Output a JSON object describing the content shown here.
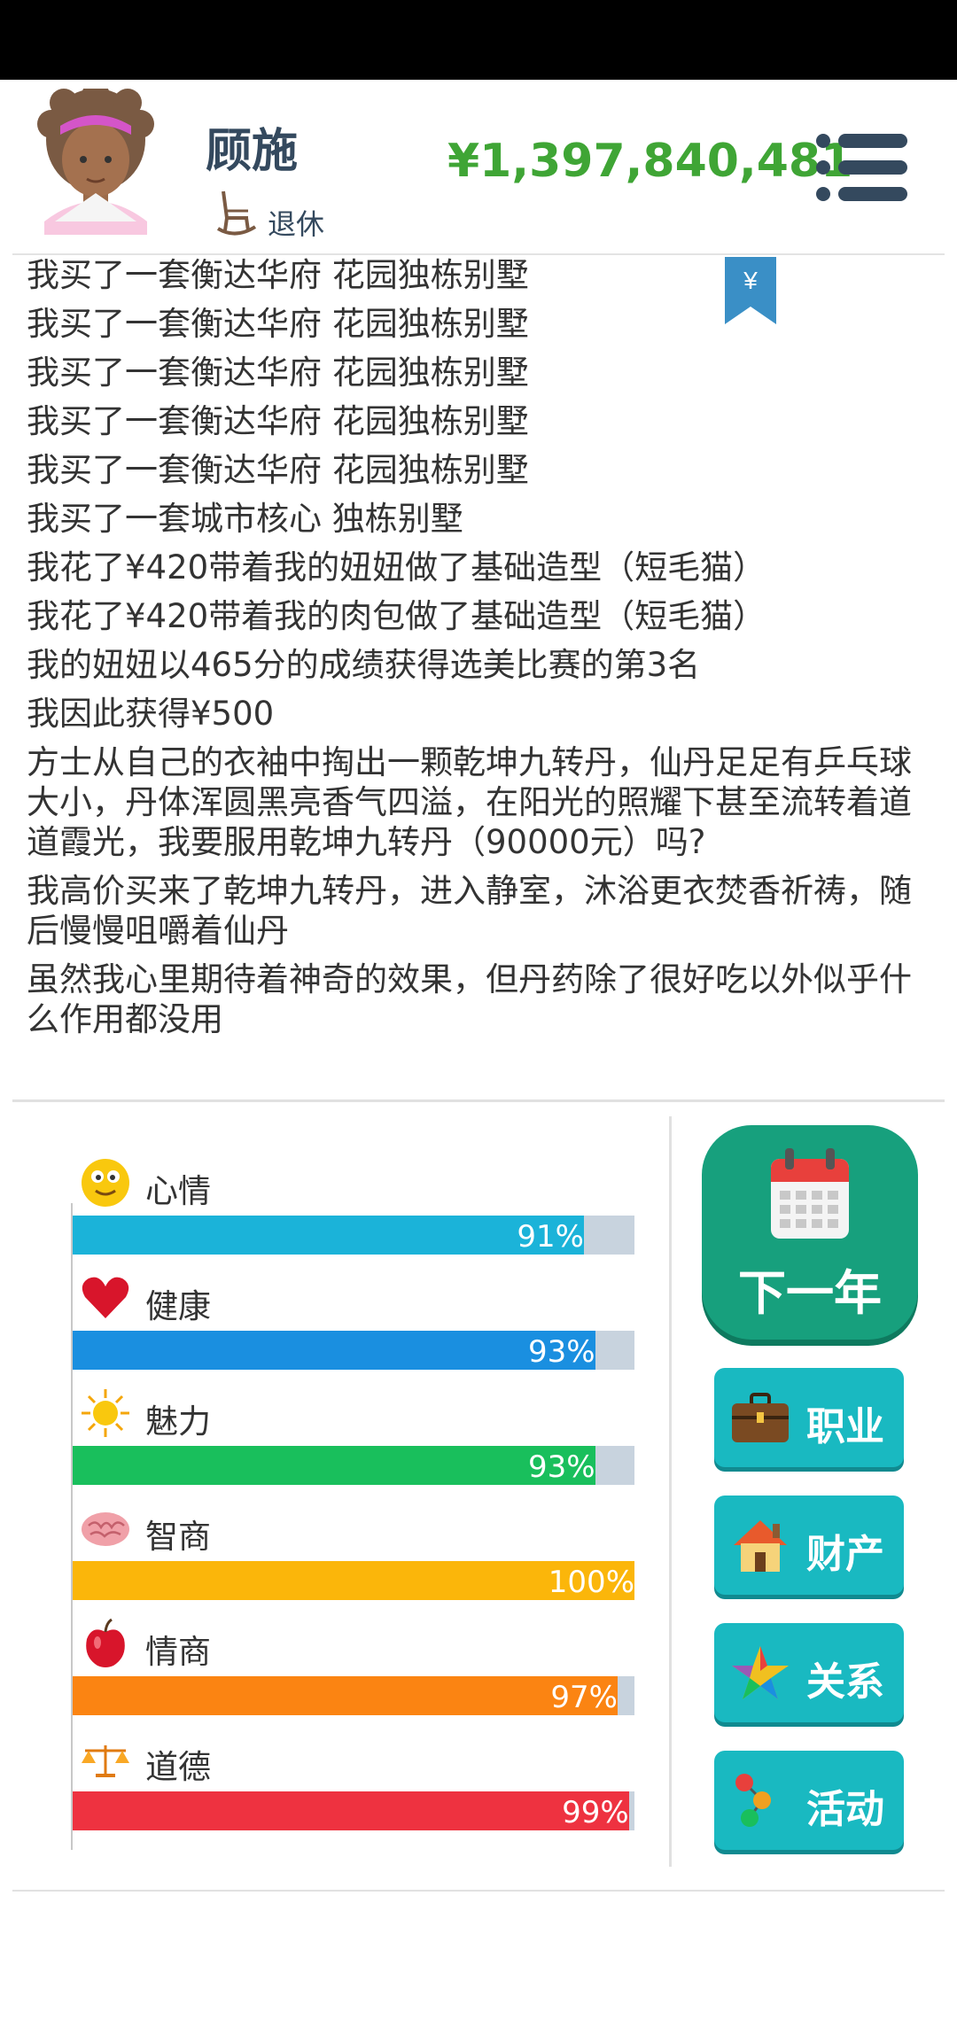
{
  "header": {
    "name": "顾施",
    "job": "退休",
    "money": "¥1,397,840,481"
  },
  "log": [
    "我买了一套衡达华府 花园独栋别墅",
    "我买了一套衡达华府 花园独栋别墅",
    "我买了一套衡达华府 花园独栋别墅",
    "我买了一套衡达华府 花园独栋别墅",
    "我买了一套衡达华府 花园独栋别墅",
    "我买了一套城市核心 独栋别墅",
    "我花了¥420带着我的妞妞做了基础造型（短毛猫）",
    "我花了¥420带着我的肉包做了基础造型（短毛猫）",
    "我的妞妞以465分的成绩获得选美比赛的第3名",
    "我因此获得¥500",
    "方士从自己的衣袖中掏出一颗乾坤九转丹，仙丹足足有乒乓球大小，丹体浑圆黑亮香气四溢，在阳光的照耀下甚至流转着道道霞光，我要服用乾坤九转丹（90000元）吗?",
    "我高价买来了乾坤九转丹，进入静室，沐浴更衣焚香祈祷，随后慢慢咀嚼着仙丹",
    "虽然我心里期待着神奇的效果，但丹药除了很好吃以外似乎什么作用都没用"
  ],
  "bookmark_symbol": "¥",
  "stats": [
    {
      "label": "心情",
      "value": 91,
      "pct": "91%",
      "color": "#1bb3d9",
      "icon": "smiley-icon"
    },
    {
      "label": "健康",
      "value": 93,
      "pct": "93%",
      "color": "#1a8fe0",
      "icon": "heart-icon"
    },
    {
      "label": "魅力",
      "value": 93,
      "pct": "93%",
      "color": "#19bf5c",
      "icon": "sun-icon"
    },
    {
      "label": "智商",
      "value": 100,
      "pct": "100%",
      "color": "#fbb60a",
      "icon": "brain-icon"
    },
    {
      "label": "情商",
      "value": 97,
      "pct": "97%",
      "color": "#fb8412",
      "icon": "apple-icon"
    },
    {
      "label": "道德",
      "value": 99,
      "pct": "99%",
      "color": "#ee3240",
      "icon": "scales-icon"
    }
  ],
  "buttons": {
    "next_year": "下一年",
    "career": "职业",
    "property": "财产",
    "relations": "关系",
    "activities": "活动"
  }
}
